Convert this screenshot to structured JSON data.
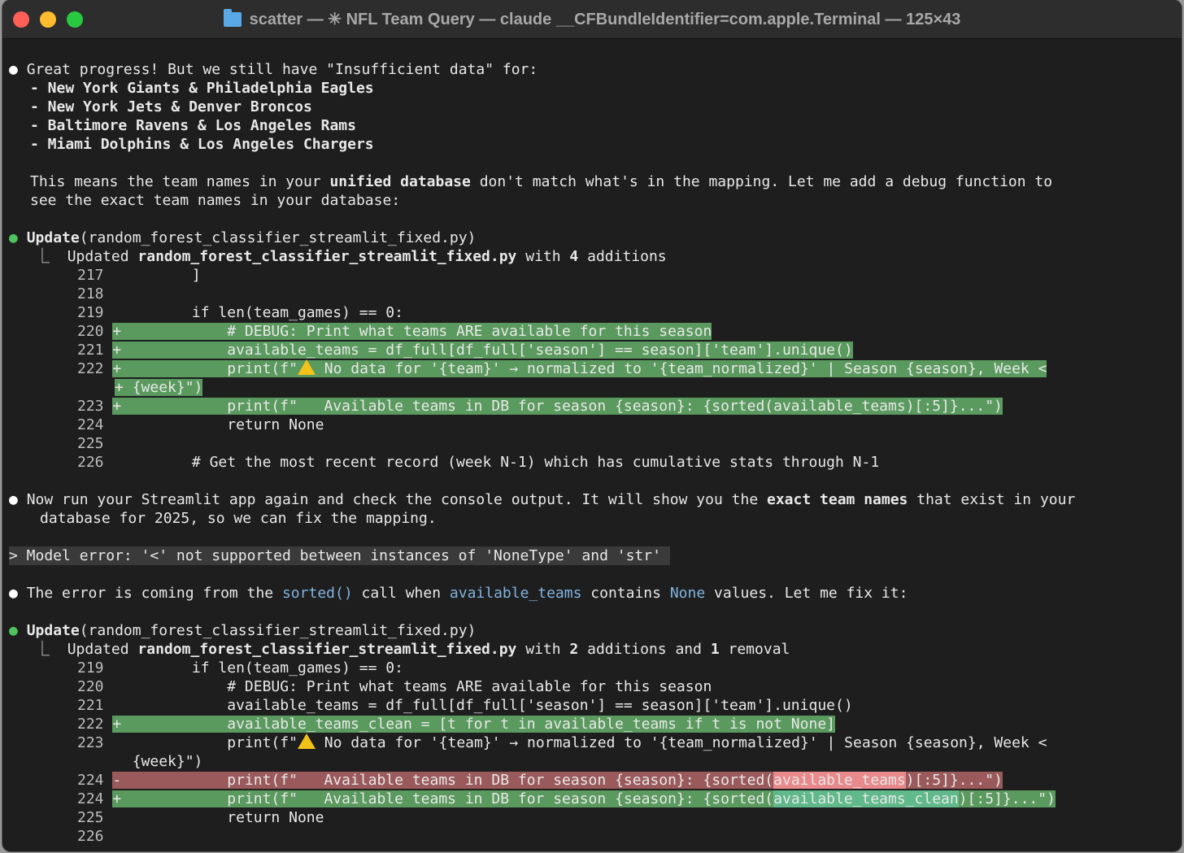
{
  "window": {
    "title": "scatter — ✳ NFL Team Query — claude __CFBundleIdentifier=com.apple.Terminal — 125×43"
  },
  "icons": {
    "folder": "folder-icon",
    "warning": "warning-icon"
  },
  "colors": {
    "diff_add": "#5a9a5e",
    "diff_remove": "#9a5a5c",
    "tool_bullet": "#4ec35e"
  },
  "msg1": {
    "bullet": "●",
    "line1": "Great progress! But we still have \"Insufficient data\" for:",
    "items": [
      "- New York Giants & Philadelphia Eagles",
      "- New York Jets & Denver Broncos",
      "- Baltimore Ravens & Los Angeles Rams",
      "- Miami Dolphins & Los Angeles Chargers"
    ],
    "p2a": "This means the team names in your ",
    "p2b": "unified database",
    "p2c": " don't match what's in the mapping. Let me add a debug function to",
    "p2d": "see the exact team names in your database:"
  },
  "update1": {
    "bullet": "●",
    "verb": "Update",
    "arg": "(random_forest_classifier_streamlit_fixed.py)",
    "corner": "⎿",
    "s1": "Updated ",
    "file": "random_forest_classifier_streamlit_fixed.py",
    "s2": " with ",
    "n1": "4",
    "s3": " additions",
    "lines": [
      {
        "n": "217",
        "m": " ",
        "t": "        ]"
      },
      {
        "n": "218",
        "m": " ",
        "t": ""
      },
      {
        "n": "219",
        "m": " ",
        "t": "        if len(team_games) == 0:"
      },
      {
        "n": "220",
        "m": "+",
        "t": "            # DEBUG: Print what teams ARE available for this season"
      },
      {
        "n": "221",
        "m": "+",
        "t": "            available_teams = df_full[df_full['season'] == season]['team'].unique()"
      },
      {
        "n": "222",
        "m": "+",
        "t1": "            print(f\"",
        "t2": " No data for '{team}' → normalized to '{team_normalized}' | Season {season}, Week <"
      },
      {
        "n": "",
        "m": "+",
        "t": "{week}\")"
      },
      {
        "n": "223",
        "m": "+",
        "t": "            print(f\"   Available teams in DB for season {season}: {sorted(available_teams)[:5]}...\")"
      },
      {
        "n": "224",
        "m": " ",
        "t": "            return None"
      },
      {
        "n": "225",
        "m": " ",
        "t": ""
      },
      {
        "n": "226",
        "m": " ",
        "t": "        # Get the most recent record (week N-1) which has cumulative stats through N-1"
      }
    ]
  },
  "msg2": {
    "bullet": "●",
    "a": "Now run your Streamlit app again and check the console output. It will show you the ",
    "b": "exact team names",
    "c": " that exist in your",
    "d": "database for 2025, so we can fix the mapping."
  },
  "prompt": {
    "text": "> Model error: '<' not supported between instances of 'NoneType' and 'str' "
  },
  "msg3": {
    "bullet": "●",
    "a": "The error is coming from the ",
    "b": "sorted()",
    "c": " call when ",
    "d": "available_teams",
    "e": " contains ",
    "f": "None",
    "g": " values. Let me fix it:"
  },
  "update2": {
    "bullet": "●",
    "verb": "Update",
    "arg": "(random_forest_classifier_streamlit_fixed.py)",
    "corner": "⎿",
    "s1": "Updated ",
    "file": "random_forest_classifier_streamlit_fixed.py",
    "s2": " with ",
    "n1": "2",
    "s3": " additions and ",
    "n2": "1",
    "s4": " removal",
    "lines": [
      {
        "n": "219",
        "m": " ",
        "t": "        if len(team_games) == 0:"
      },
      {
        "n": "220",
        "m": " ",
        "t": "            # DEBUG: Print what teams ARE available for this season"
      },
      {
        "n": "221",
        "m": " ",
        "t": "            available_teams = df_full[df_full['season'] == season]['team'].unique()"
      },
      {
        "n": "222",
        "m": "+",
        "t": "            available_teams_clean = [t for t in available_teams if t is not None]"
      },
      {
        "n": "223",
        "m": " ",
        "t1": "            print(f\"",
        "t2": " No data for '{team}' → normalized to '{team_normalized}' | Season {season}, Week <"
      },
      {
        "n": "",
        "m": " ",
        "t": "{week}\")"
      },
      {
        "n": "224",
        "m": "-",
        "t1": "            print(f\"   Available teams in DB for season {season}: {sorted(",
        "hl": "available_teams",
        "t2": ")[:5]}...\")"
      },
      {
        "n": "224",
        "m": "+",
        "t1": "            print(f\"   Available teams in DB for season {season}: {sorted(",
        "hl": "available_teams_clean",
        "t2": ")[:5]}...\")"
      },
      {
        "n": "225",
        "m": " ",
        "t": "            return None"
      },
      {
        "n": "226",
        "m": " ",
        "t": ""
      }
    ]
  }
}
